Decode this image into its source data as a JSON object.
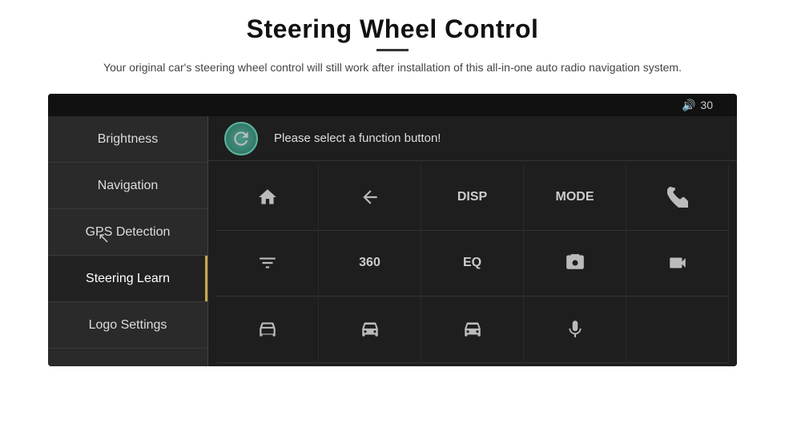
{
  "header": {
    "title": "Steering Wheel Control",
    "divider": true,
    "subtitle": "Your original car's steering wheel control will still work after installation of this all-in-one auto radio navigation system."
  },
  "radio": {
    "volume": {
      "label": "30"
    },
    "sidebar": {
      "items": [
        {
          "id": "brightness",
          "label": "Brightness",
          "active": false
        },
        {
          "id": "navigation",
          "label": "Navigation",
          "active": false
        },
        {
          "id": "gps-detection",
          "label": "GPS Detection",
          "active": false
        },
        {
          "id": "steering-learn",
          "label": "Steering Learn",
          "active": true
        },
        {
          "id": "logo-settings",
          "label": "Logo Settings",
          "active": false
        }
      ]
    },
    "content": {
      "header_text": "Please select a function button!",
      "refresh_title": "Refresh",
      "grid": [
        {
          "row": 0,
          "col": 0,
          "type": "icon",
          "icon": "home",
          "label": ""
        },
        {
          "row": 0,
          "col": 1,
          "type": "icon",
          "icon": "back",
          "label": ""
        },
        {
          "row": 0,
          "col": 2,
          "type": "label",
          "icon": "",
          "label": "DISP"
        },
        {
          "row": 0,
          "col": 3,
          "type": "label",
          "icon": "",
          "label": "MODE"
        },
        {
          "row": 0,
          "col": 4,
          "type": "icon",
          "icon": "phone-off",
          "label": ""
        },
        {
          "row": 1,
          "col": 0,
          "type": "icon",
          "icon": "equalizer",
          "label": ""
        },
        {
          "row": 1,
          "col": 1,
          "type": "label",
          "icon": "",
          "label": "360"
        },
        {
          "row": 1,
          "col": 2,
          "type": "label",
          "icon": "",
          "label": "EQ"
        },
        {
          "row": 1,
          "col": 3,
          "type": "icon",
          "icon": "camera",
          "label": ""
        },
        {
          "row": 1,
          "col": 4,
          "type": "icon",
          "icon": "camera2",
          "label": ""
        },
        {
          "row": 2,
          "col": 0,
          "type": "icon",
          "icon": "car-front",
          "label": ""
        },
        {
          "row": 2,
          "col": 1,
          "type": "icon",
          "icon": "car-side",
          "label": ""
        },
        {
          "row": 2,
          "col": 2,
          "type": "icon",
          "icon": "car-back",
          "label": ""
        },
        {
          "row": 2,
          "col": 3,
          "type": "icon",
          "icon": "mic",
          "label": ""
        },
        {
          "row": 2,
          "col": 4,
          "type": "empty",
          "icon": "",
          "label": ""
        }
      ]
    }
  }
}
